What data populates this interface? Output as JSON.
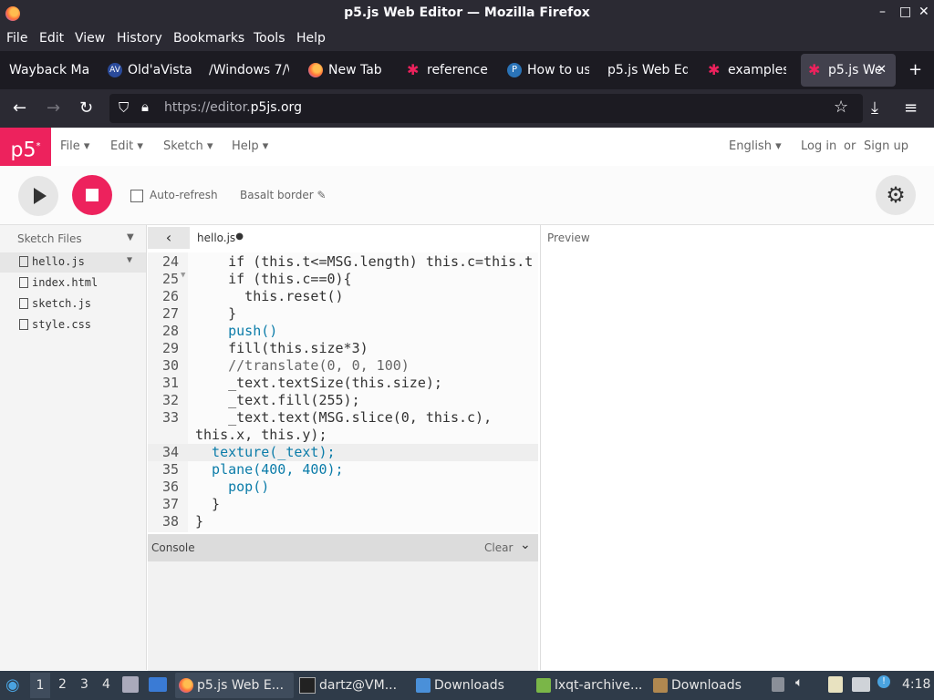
{
  "window": {
    "title": "p5.js Web Editor — Mozilla Firefox"
  },
  "menubar": {
    "items": [
      "File",
      "Edit",
      "View",
      "History",
      "Bookmarks",
      "Tools",
      "Help"
    ]
  },
  "tabs": [
    {
      "label": "Wayback Ma",
      "icon": "none"
    },
    {
      "label": "Old'aVista",
      "icon": "av-icon"
    },
    {
      "label": "/Windows 7/\\",
      "icon": "none"
    },
    {
      "label": "New Tab",
      "icon": "firefox-icon"
    },
    {
      "label": "reference",
      "icon": "p5-star-icon"
    },
    {
      "label": "How to us",
      "icon": "p-icon"
    },
    {
      "label": "p5.js Web Ed",
      "icon": "none"
    },
    {
      "label": "examples",
      "icon": "p5-star-icon"
    },
    {
      "label": "p5.js We",
      "icon": "p5-star-icon",
      "active": true
    }
  ],
  "nav": {
    "url_prefix": "https://editor.",
    "url_domain": "p5js.org"
  },
  "p5": {
    "logo": "p5",
    "menu": [
      "File",
      "Edit",
      "Sketch",
      "Help"
    ],
    "language": "English",
    "login": "Log in",
    "or": "or",
    "signup": "Sign up",
    "auto_refresh": "Auto-refresh",
    "sketch_name": "Basalt border",
    "sketch_files": "Sketch Files",
    "files": [
      "hello.js",
      "index.html",
      "sketch.js",
      "style.css"
    ],
    "open_file": "hello.js",
    "preview": "Preview",
    "console": "Console",
    "clear": "Clear"
  },
  "code": {
    "lines": [
      {
        "n": "24",
        "text": "    if (this.t<=MSG.length) this.c=this.t"
      },
      {
        "n": "25",
        "text": "    if (this.c==0){"
      },
      {
        "n": "26",
        "text": "      this.reset()"
      },
      {
        "n": "27",
        "text": "    }"
      },
      {
        "n": "28",
        "text": "    push()"
      },
      {
        "n": "29",
        "text": "    fill(this.size*3)"
      },
      {
        "n": "30",
        "text": "    //translate(0, 0, 100)"
      },
      {
        "n": "31",
        "text": "    _text.textSize(this.size);"
      },
      {
        "n": "32",
        "text": "    _text.fill(255);"
      },
      {
        "n": "33",
        "text": "    _text.text(MSG.slice(0, this.c),"
      },
      {
        "n": "",
        "text": "this.x, this.y);"
      },
      {
        "n": "34",
        "text": "  texture(_text);"
      },
      {
        "n": "35",
        "text": "  plane(400, 400);"
      },
      {
        "n": "36",
        "text": "    pop()"
      },
      {
        "n": "37",
        "text": "  }"
      },
      {
        "n": "38",
        "text": "}"
      }
    ]
  },
  "taskbar": {
    "workspaces": [
      "1",
      "2",
      "3",
      "4"
    ],
    "apps": [
      {
        "label": "p5.js Web E...",
        "icon": "firefox-icon",
        "active": true
      },
      {
        "label": "dartz@VM...",
        "icon": "terminal-icon"
      },
      {
        "label": "Downloads",
        "icon": "folder-icon"
      },
      {
        "label": "lxqt-archive...",
        "icon": "archive-icon"
      },
      {
        "label": "Downloads",
        "icon": "folder-icon"
      }
    ],
    "clock": "4:18"
  }
}
